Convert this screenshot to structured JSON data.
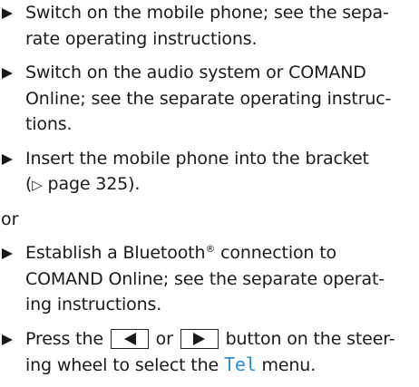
{
  "steps": {
    "s1": {
      "line1": "Switch on the mobile phone; see the sepa-",
      "line2": "rate operating instructions."
    },
    "s2": {
      "line1": "Switch on the audio system or COMAND",
      "line2": "Online; see the separate operating instruc-",
      "line3": "tions."
    },
    "s3": {
      "line1": "Insert the mobile phone into the bracket",
      "ref_symbol": "▷",
      "ref_text": "page 325",
      "open_paren": "(",
      "close_paren": ")."
    },
    "or_label": "or",
    "s4": {
      "line1_pre": "Establish a Bluetooth",
      "reg": "®",
      "line1_post": " connection to",
      "line2": "COMAND Online; see the separate operat-",
      "line3": "ing instructions."
    },
    "s5": {
      "press": "Press the",
      "or": "or",
      "after": "button on the steer-",
      "line2_pre": "ing wheel to select the",
      "menu": "Tel",
      "line2_post": "menu."
    }
  },
  "icons": {
    "bullet": "triangle-right-bullet",
    "left_button": "arrow-left-button",
    "right_button": "arrow-right-button"
  },
  "colors": {
    "text": "#1a1a1a",
    "menu_accent": "#2a8fd6"
  }
}
